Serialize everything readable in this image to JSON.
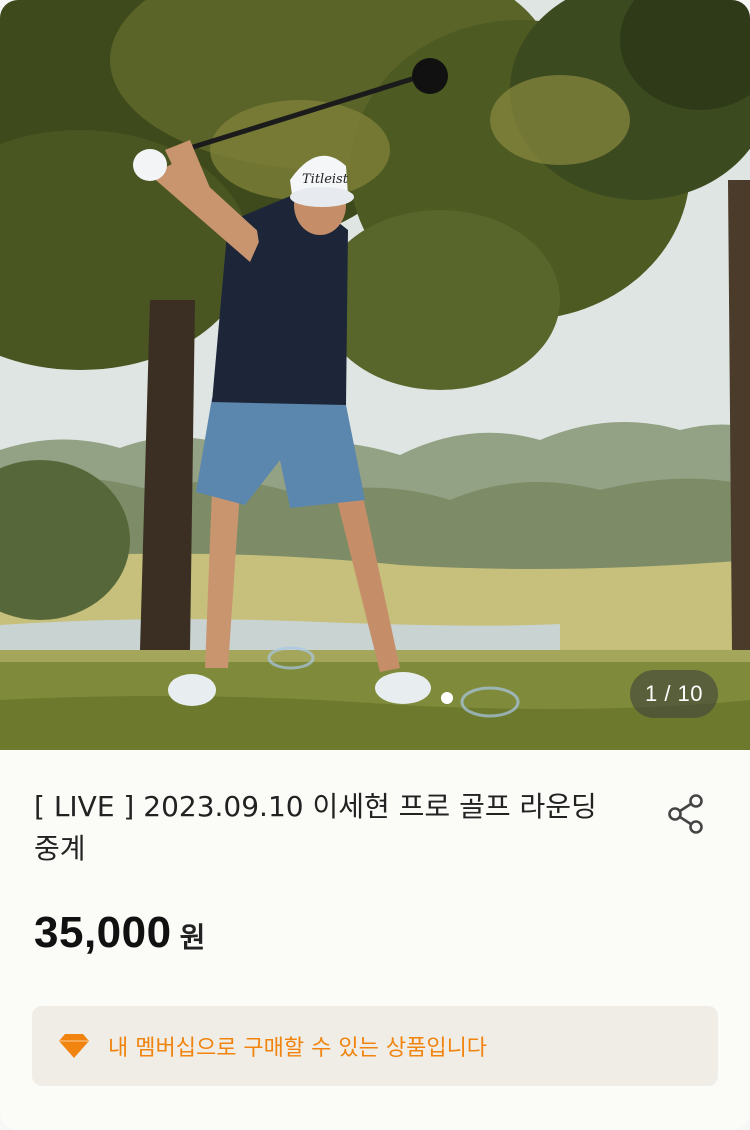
{
  "product": {
    "image_alt": "golfer swinging a driver on a golf course",
    "image_counter": "1 / 10",
    "title": "[ LIVE ] 2023.09.10 이세현 프로 골프 라운딩 중계",
    "price": "35,000",
    "currency": "원",
    "membership_notice": "내 멤버십으로 구매할 수 있는 상품입니다"
  },
  "icons": {
    "share": "share-icon",
    "membership": "diamond-icon"
  },
  "colors": {
    "accent": "#f0840f",
    "notice_bg": "#f0ede7",
    "title": "#222222"
  }
}
